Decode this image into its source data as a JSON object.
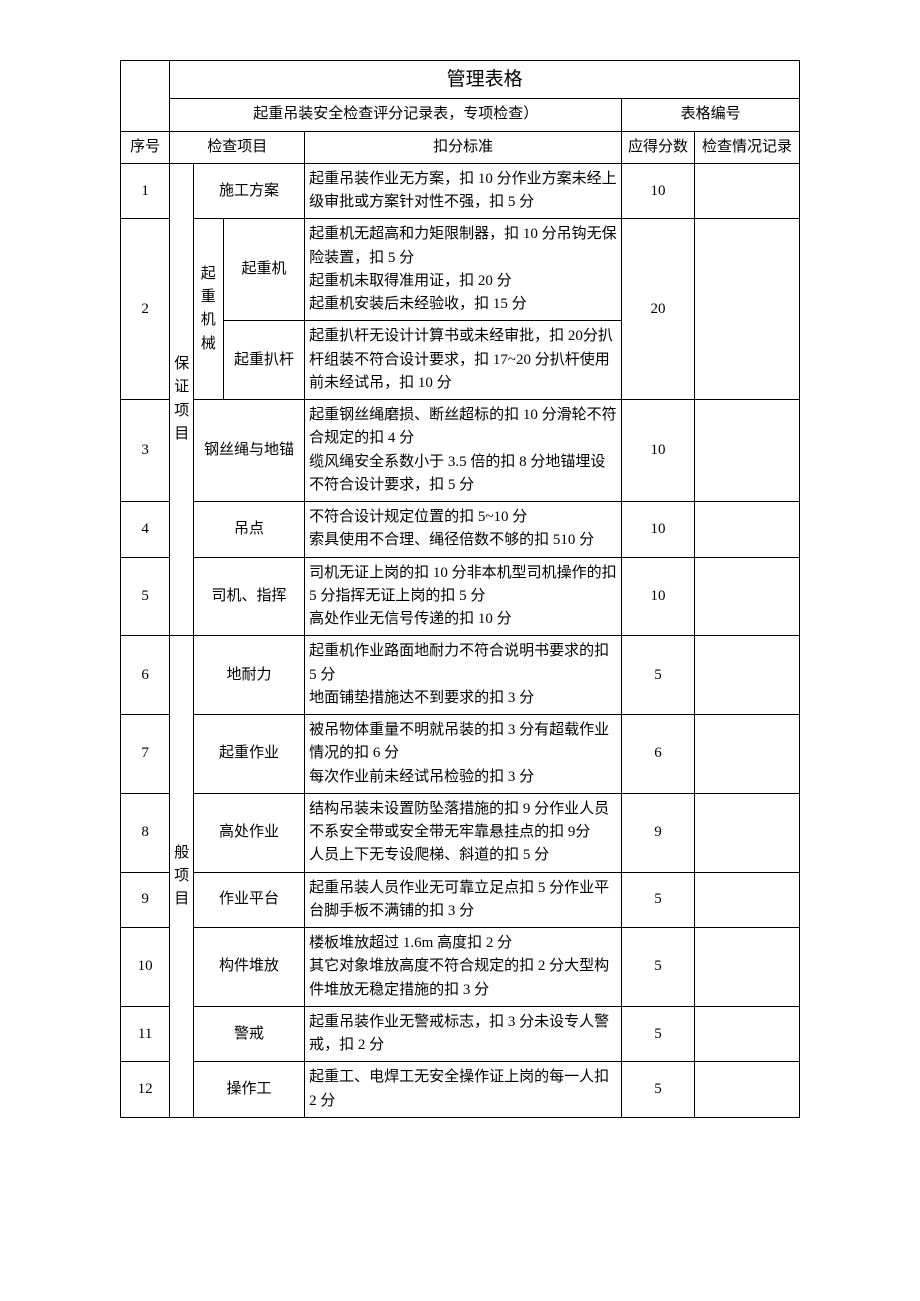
{
  "header": {
    "main_title": "管理表格",
    "sub_title": "起重吊装安全检查评分记录表，专项检查）",
    "form_number_label": "表格编号"
  },
  "columns": {
    "seq": "序号",
    "item": "检查项目",
    "standard": "扣分标准",
    "score": "应得分数",
    "note": "检查情况记录"
  },
  "cat1": "保证项目",
  "cat2": "般项目",
  "sub_lifting": "起重机械",
  "rows": {
    "r1": {
      "seq": "1",
      "sub": "施工方案",
      "std": "起重吊装作业无方案，扣 10 分作业方案未经上级审批或方案针对性不强，扣 5 分",
      "score": "10"
    },
    "r2a": {
      "seq": "2",
      "sub": "起重机",
      "std": "起重机无超高和力矩限制器，扣 10 分吊钩无保险装置，扣 5 分\n起重机未取得准用证，扣 20 分\n起重机安装后未经验收，扣 15 分",
      "score": "20"
    },
    "r2b": {
      "sub": "起重扒杆",
      "std": "起重扒杆无设计计算书或未经审批，扣 20分扒杆组装不符合设计要求，扣 17~20 分扒杆使用前未经试吊，扣 10 分"
    },
    "r3": {
      "seq": "3",
      "sub": "钢丝绳与地锚",
      "std": "起重钢丝绳磨损、断丝超标的扣 10 分滑轮不符合规定的扣 4 分\n缆风绳安全系数小于 3.5 倍的扣 8 分地锚埋设不符合设计要求，扣 5 分",
      "score": "10"
    },
    "r4": {
      "seq": "4",
      "sub": "吊点",
      "std": "不符合设计规定位置的扣 5~10 分\n索具使用不合理、绳径倍数不够的扣 510 分",
      "score": "10"
    },
    "r5": {
      "seq": "5",
      "sub": "司机、指挥",
      "std": "司机无证上岗的扣 10 分非本机型司机操作的扣 5 分指挥无证上岗的扣 5 分\n高处作业无信号传递的扣 10 分",
      "score": "10"
    },
    "r6": {
      "seq": "6",
      "sub": "地耐力",
      "std": "起重机作业路面地耐力不符合说明书要求的扣 5 分\n地面铺垫措施达不到要求的扣 3 分",
      "score": "5"
    },
    "r7": {
      "seq": "7",
      "sub": "起重作业",
      "std": "被吊物体重量不明就吊装的扣 3 分有超载作业情况的扣 6 分\n每次作业前未经试吊检验的扣 3 分",
      "score": "6"
    },
    "r8": {
      "seq": "8",
      "sub": "高处作业",
      "std": "结构吊装未设置防坠落措施的扣 9 分作业人员不系安全带或安全带无牢靠悬挂点的扣 9分\n人员上下无专设爬梯、斜道的扣 5 分",
      "score": "9"
    },
    "r9": {
      "seq": "9",
      "sub": "作业平台",
      "std": "起重吊装人员作业无可靠立足点扣 5 分作业平台脚手板不满铺的扣 3 分",
      "score": "5"
    },
    "r10": {
      "seq": "10",
      "sub": "构件堆放",
      "std": "楼板堆放超过 1.6m 高度扣 2 分\n其它对象堆放高度不符合规定的扣 2 分大型构件堆放无稳定措施的扣 3 分",
      "score": "5"
    },
    "r11": {
      "seq": "11",
      "sub": "警戒",
      "std": "起重吊装作业无警戒标志，扣 3 分未设专人警戒，扣 2 分",
      "score": "5"
    },
    "r12": {
      "seq": "12",
      "sub": "操作工",
      "std": "起重工、电焊工无安全操作证上岗的每一人扣 2 分",
      "score": "5"
    }
  }
}
